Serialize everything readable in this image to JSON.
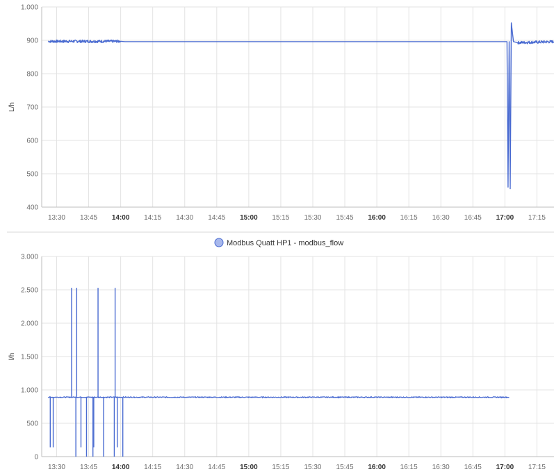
{
  "colors": {
    "series": "#4a6bd1",
    "legend_fill": "#a8b8ec",
    "grid": "#e3e3e3",
    "axis": "#bdbdbd",
    "divider": "#d8d8d8"
  },
  "chart_data": [
    {
      "type": "line",
      "ylabel": "L/h",
      "ylim": [
        400,
        1000
      ],
      "yticks": [
        "400",
        "500",
        "600",
        "700",
        "800",
        "900",
        "1.000"
      ],
      "ytick_values": [
        400,
        500,
        600,
        700,
        800,
        900,
        1000
      ],
      "xlim": [
        "13:23",
        "17:23"
      ],
      "xticks": [
        "13:30",
        "13:45",
        "14:00",
        "14:15",
        "14:30",
        "14:45",
        "15:00",
        "15:15",
        "15:30",
        "15:45",
        "16:00",
        "16:15",
        "16:30",
        "16:45",
        "17:00",
        "17:15"
      ],
      "xticks_bold": [
        "14:00",
        "15:00",
        "16:00",
        "17:00"
      ],
      "grid": true,
      "legend": false,
      "series": [
        {
          "color": "#4a6bd1",
          "x": [
            "13:26",
            "14:00",
            "14:02",
            "17:00",
            "17:01",
            "17:01",
            "17:02",
            "17:02",
            "17:03",
            "17:04",
            "17:06",
            "17:23"
          ],
          "y": [
            897,
            897,
            896,
            896,
            896,
            460,
            896,
            455,
            952,
            896,
            893,
            896
          ],
          "noisy_ranges": [
            [
              "13:26",
              "14:02"
            ],
            [
              "17:04",
              "17:23"
            ]
          ]
        }
      ]
    },
    {
      "type": "line",
      "ylabel": "l/h",
      "ylim": [
        0,
        3000
      ],
      "yticks": [
        "0",
        "500",
        "1.000",
        "1.500",
        "2.000",
        "2.500",
        "3.000"
      ],
      "ytick_values": [
        0,
        500,
        1000,
        1500,
        2000,
        2500,
        3000
      ],
      "xlim": [
        "13:23",
        "17:23"
      ],
      "xticks": [
        "13:30",
        "13:45",
        "14:00",
        "14:15",
        "14:30",
        "14:45",
        "15:00",
        "15:15",
        "15:30",
        "15:45",
        "16:00",
        "16:15",
        "16:30",
        "16:45",
        "17:00",
        "17:15"
      ],
      "xticks_bold": [
        "14:00",
        "15:00",
        "16:00",
        "17:00"
      ],
      "grid": true,
      "legend": "top-center",
      "series": [
        {
          "name": "Modbus Quatt HP1 - modbus_flow",
          "color": "#4a6bd1",
          "base": 890,
          "x_range": [
            "13:26",
            "17:02"
          ],
          "spikes": [
            {
              "x": "13:27",
              "y": 140
            },
            {
              "x": "13:28",
              "y": 140
            },
            {
              "x": "13:37",
              "y": 2530
            },
            {
              "x": "13:39",
              "y": 2530
            },
            {
              "x": "13:39",
              "y": 0
            },
            {
              "x": "13:41",
              "y": 140
            },
            {
              "x": "13:44",
              "y": 0
            },
            {
              "x": "13:47",
              "y": 140
            },
            {
              "x": "13:47",
              "y": 0
            },
            {
              "x": "13:49",
              "y": 2530
            },
            {
              "x": "13:52",
              "y": 0
            },
            {
              "x": "13:57",
              "y": 2530
            },
            {
              "x": "13:57",
              "y": 0
            },
            {
              "x": "13:58",
              "y": 140
            },
            {
              "x": "14:01",
              "y": 0
            }
          ]
        }
      ]
    }
  ]
}
